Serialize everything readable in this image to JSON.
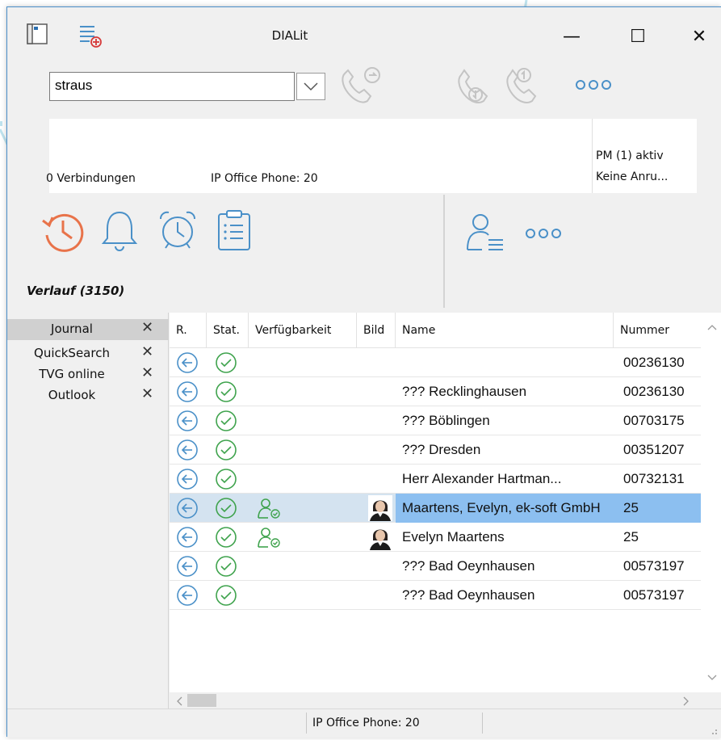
{
  "window": {
    "title": "DIALit",
    "minimize": "—",
    "maximize": "☐",
    "close": "✕"
  },
  "search": {
    "value": "straus"
  },
  "info": {
    "connections": "0 Verbindungen",
    "phone": "IP Office Phone: 20",
    "pm_status": "PM (1) aktiv",
    "calls": "Keine Anru..."
  },
  "section_label": "Verlauf (3150)",
  "tabs": [
    {
      "label": "Journal",
      "close": "✕"
    },
    {
      "label": "QuickSearch",
      "close": "✕"
    },
    {
      "label": "TVG online",
      "close": "✕"
    },
    {
      "label": "Outlook",
      "close": "✕"
    }
  ],
  "grid": {
    "columns": [
      "R.",
      "Stat.",
      "Verfügbarkeit",
      "Bild",
      "Name",
      "Nummer"
    ],
    "rows": [
      {
        "name": "",
        "number": "00236130",
        "avail": false,
        "photo": false,
        "selected": false
      },
      {
        "name": "??? Recklinghausen",
        "number": "00236130",
        "avail": false,
        "photo": false,
        "selected": false
      },
      {
        "name": "??? Böblingen",
        "number": "00703175",
        "avail": false,
        "photo": false,
        "selected": false
      },
      {
        "name": "??? Dresden",
        "number": "00351207",
        "avail": false,
        "photo": false,
        "selected": false
      },
      {
        "name": "Herr Alexander Hartman...",
        "number": "00732131",
        "avail": false,
        "photo": false,
        "selected": false
      },
      {
        "name": "Maartens, Evelyn, ek-soft GmbH",
        "number": "25",
        "avail": true,
        "photo": true,
        "selected": true
      },
      {
        "name": "Evelyn Maartens",
        "number": "25",
        "avail": true,
        "photo": true,
        "selected": false
      },
      {
        "name": "??? Bad Oeynhausen",
        "number": "00573197",
        "avail": false,
        "photo": false,
        "selected": false
      },
      {
        "name": "??? Bad Oeynhausen",
        "number": "00573197",
        "avail": false,
        "photo": false,
        "selected": false
      }
    ]
  },
  "status_bar": {
    "phone": "IP Office Phone: 20"
  },
  "colors": {
    "accent_orange": "#e8734a",
    "icon_blue": "#4a90c8",
    "selection": "#8cbff0",
    "row_selected": "#d4e3f0",
    "check_green": "#3fa34d"
  },
  "icons": {
    "history": "history-icon",
    "bell": "bell-icon",
    "alarm": "alarm-clock-icon",
    "clipboard": "clipboard-icon",
    "contacts_list": "contact-list-icon",
    "more": "more-icon"
  }
}
